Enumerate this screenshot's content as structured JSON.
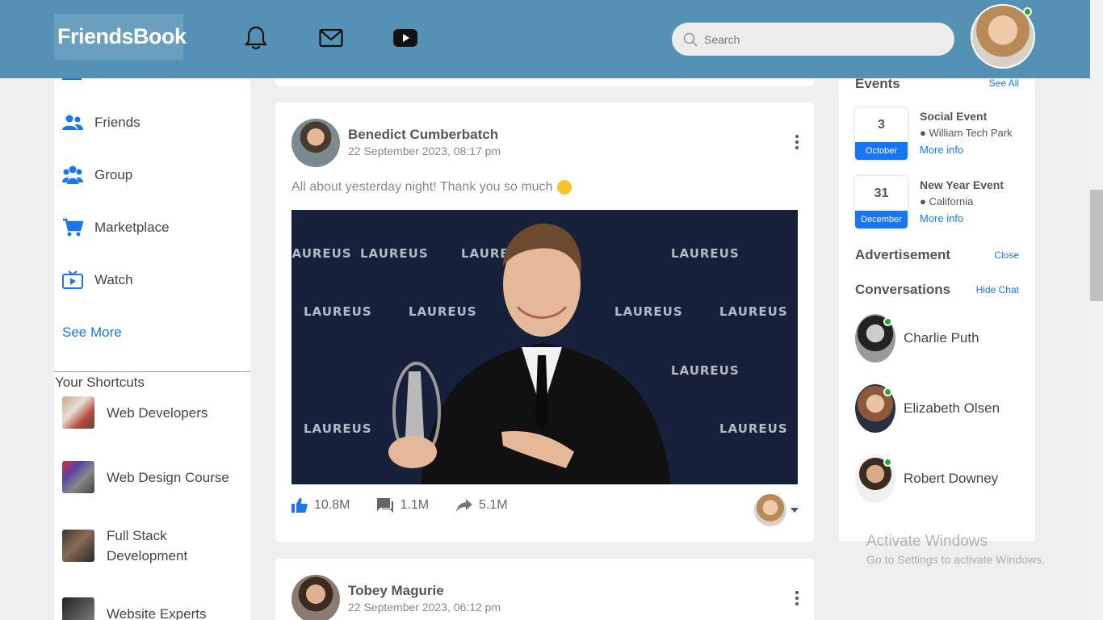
{
  "header": {
    "logo": "FriendsBook",
    "search_placeholder": "Search"
  },
  "left_menu": {
    "items": [
      {
        "label": "Friends",
        "icon": "friends-icon"
      },
      {
        "label": "Group",
        "icon": "group-icon"
      },
      {
        "label": "Marketplace",
        "icon": "cart-icon"
      },
      {
        "label": "Watch",
        "icon": "watch-icon"
      }
    ],
    "see_more": "See More",
    "shortcuts_title": "Your Shortcuts",
    "shortcuts": [
      {
        "label": "Web Developers"
      },
      {
        "label": "Web Design Course"
      },
      {
        "label": "Full Stack Development"
      },
      {
        "label": "Website Experts"
      }
    ]
  },
  "posts": [
    {
      "author": "Benedict Cumberbatch",
      "date": "22 September 2023, 08:17 pm",
      "text": "All about yesterday night! Thank you so much",
      "image_text": "LAUREUS",
      "likes": "10.8M",
      "comments": "1.1M",
      "shares": "5.1M"
    },
    {
      "author": "Tobey Magurie",
      "date": "22 September 2023, 06:12 pm"
    }
  ],
  "right": {
    "events_title": "Events",
    "events_link": "See All",
    "events": [
      {
        "day": "3",
        "month": "October",
        "title": "Social Event",
        "place": "William Tech Park",
        "more": "More info"
      },
      {
        "day": "31",
        "month": "December",
        "title": "New Year Event",
        "place": "California",
        "more": "More info"
      }
    ],
    "ad_title": "Advertisement",
    "ad_link": "Close",
    "conv_title": "Conversations",
    "conv_link": "Hide Chat",
    "chats": [
      {
        "name": "Charlie Puth"
      },
      {
        "name": "Elizabeth Olsen"
      },
      {
        "name": "Robert Downey"
      }
    ]
  },
  "watermark": {
    "line1": "Activate Windows",
    "line2": "Go to Settings to activate Windows."
  },
  "colors": {
    "header": "#5591b4",
    "accent": "#1876f2",
    "online": "#1eaa2c"
  }
}
